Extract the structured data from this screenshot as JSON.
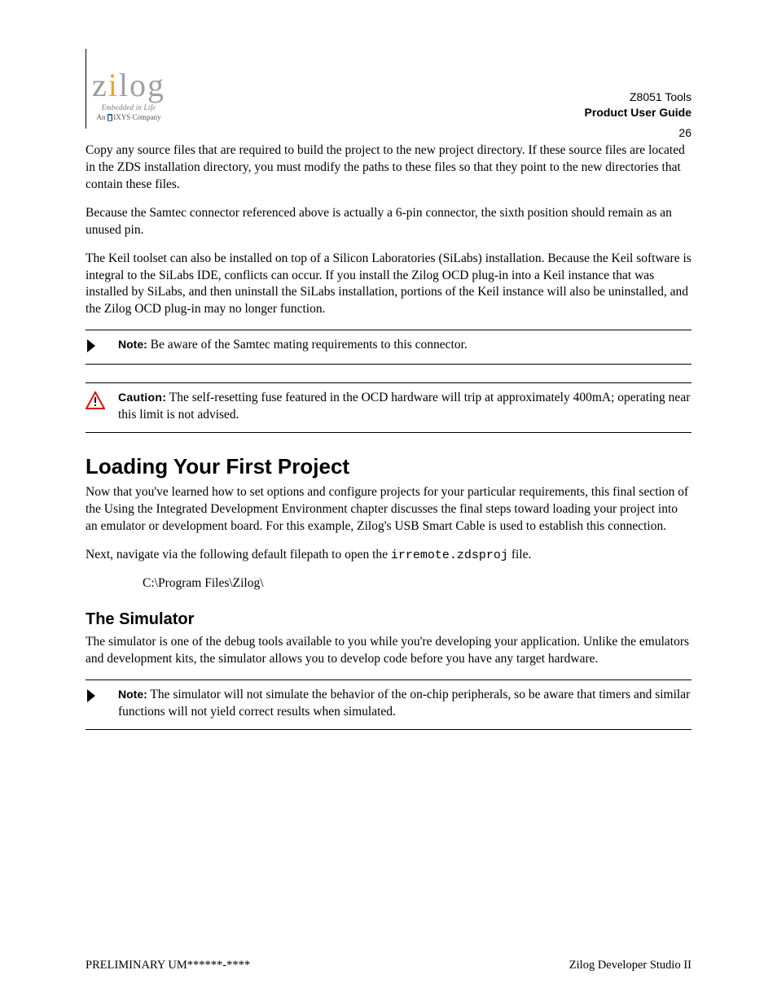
{
  "logo": {
    "word": "zilog",
    "tagline": "Embedded in Life",
    "subline_prefix": "An ",
    "subline_brand": "IXYS",
    "subline_suffix": " Company"
  },
  "header": {
    "product_line1": "Z8051 Tools",
    "product_line2": "Product User Guide",
    "page_number": "26"
  },
  "paragraphs": {
    "p1": "Copy any source files that are required to build the project to the new project directory. If these source files are located in the ZDS installation directory, you must modify the paths to these files so that they point to the new directories that contain these files.",
    "p2": "Because the Samtec connector referenced above is actually a 6-pin connector, the sixth position should remain as an unused pin.",
    "p3": "The Keil toolset can also be installed on top of a Silicon Laboratories (SiLabs) installation. Because the Keil software is integral to the SiLabs IDE, conflicts can occur. If you install the Zilog OCD plug-in into a Keil instance that was installed by SiLabs, and then uninstall the SiLabs installation, portions of the Keil instance will also be uninstalled, and the Zilog OCD plug-in may no longer function."
  },
  "note": {
    "label": "Note:",
    "text": " Be aware of the Samtec mating requirements to this connector."
  },
  "caution": {
    "label": "Caution:",
    "text": " The self-resetting fuse featured in the OCD hardware will trip at approximately 400mA; operating near this limit is not advised."
  },
  "sections": {
    "loading": {
      "title": "Loading Your First Project",
      "lead": "Now that you've learned how to set options and configure projects for your particular requirements, this final section of the Using the Integrated Development Environment chapter discusses the final steps toward loading your project into an emulator or development board. For this example, Zilog's USB Smart Cable is used to establish this connection.",
      "file_line_prefix": "Next, navigate via the following default filepath to open the ",
      "file_name": "irremote.zdsproj",
      "file_line_suffix": " file.",
      "path": "C:\\Program Files\\Zilog\\"
    },
    "simulator": {
      "title": "The Simulator",
      "lead": "The simulator is one of the debug tools available to you while you're developing your application. Unlike the emulators and development kits, the simulator allows you to develop code before you have any target hardware."
    }
  },
  "note2": {
    "label": "Note:",
    "text": " The simulator will not simulate the behavior of the on-chip peripherals, so be aware that timers and similar functions will not yield correct results when simulated."
  },
  "footer": {
    "doc_id": "PRELIMINARY UM******-****",
    "section": "Zilog Developer Studio II"
  },
  "icons": {
    "chevron": "chevron-right-icon",
    "warning": "warning-triangle-icon"
  }
}
